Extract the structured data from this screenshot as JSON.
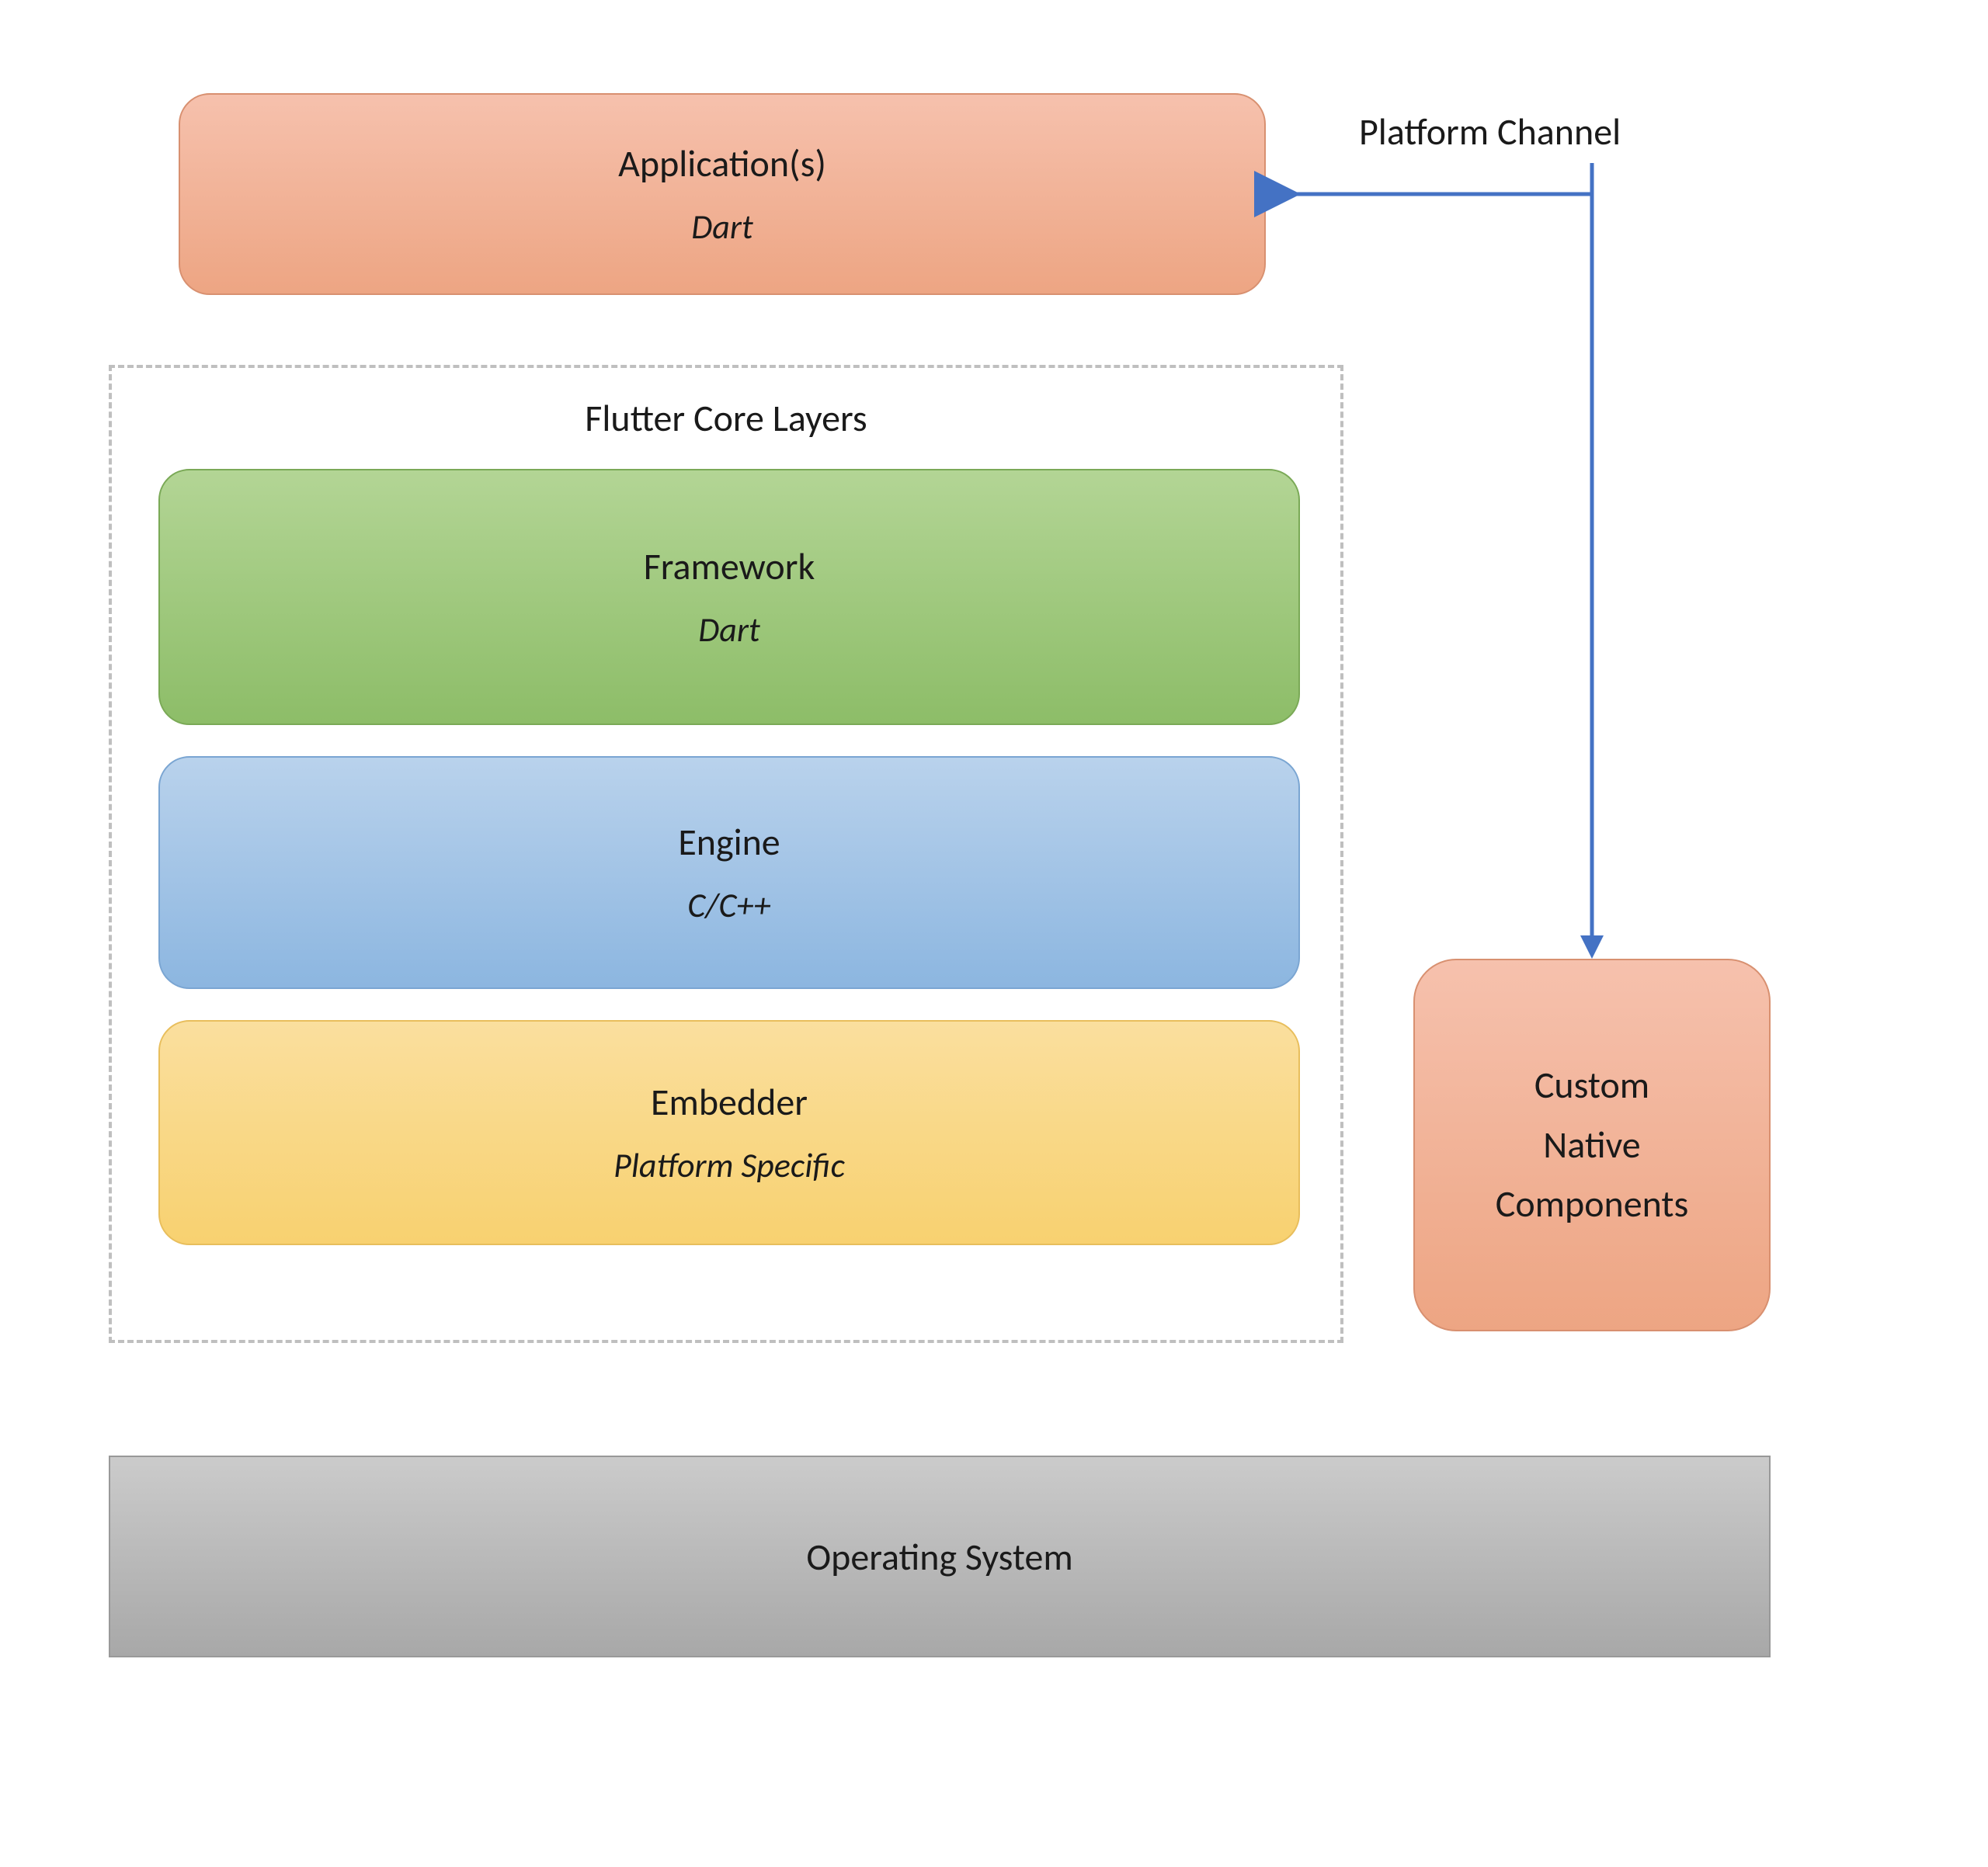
{
  "labels": {
    "platform_channel": "Platform Channel",
    "core_layers_title": "Flutter Core Layers"
  },
  "boxes": {
    "applications": {
      "title": "Application(s)",
      "subtitle": "Dart"
    },
    "framework": {
      "title": "Framework",
      "subtitle": "Dart"
    },
    "engine": {
      "title": "Engine",
      "subtitle": "C/C++"
    },
    "embedder": {
      "title": "Embedder",
      "subtitle": "Platform Specific"
    },
    "custom_native": {
      "line1": "Custom",
      "line2": "Native",
      "line3": "Components"
    },
    "os": {
      "title": "Operating System"
    }
  },
  "colors": {
    "orange_light": "#f6c1ad",
    "orange_dark": "#eda583",
    "green_light": "#b3d595",
    "green_dark": "#8dbd68",
    "blue_light": "#b9d2ec",
    "blue_dark": "#8cb6e0",
    "yellow_light": "#fadf9e",
    "yellow_dark": "#f8d170",
    "gray_light": "#cbcbcb",
    "gray_dark": "#a8a8a8",
    "arrow_blue": "#4472c4",
    "dashed_gray": "#bfbfbf"
  }
}
